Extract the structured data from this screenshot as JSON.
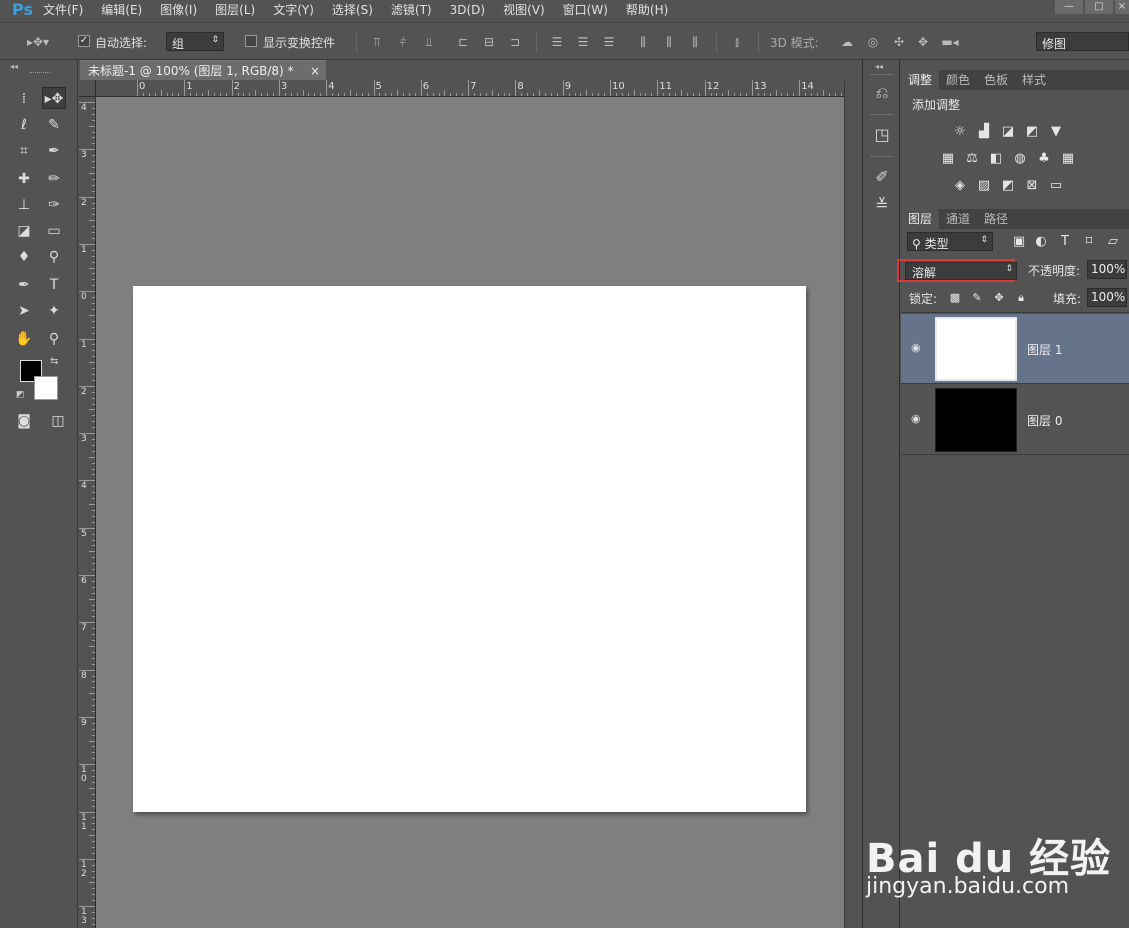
{
  "app": {
    "logo": "Ps"
  },
  "menubar": {
    "items": [
      "文件(F)",
      "编辑(E)",
      "图像(I)",
      "图层(L)",
      "文字(Y)",
      "选择(S)",
      "滤镜(T)",
      "3D(D)",
      "视图(V)",
      "窗口(W)",
      "帮助(H)"
    ]
  },
  "options": {
    "auto_select_label": "自动选择:",
    "auto_select_value": "组",
    "show_transform_label": "显示变换控件",
    "mode_3d_label": "3D 模式:",
    "workspace": "修图"
  },
  "document": {
    "tab_title": "未标题-1 @ 100% (图层 1, RGB/8) *",
    "close": "×",
    "ruler_top": [
      "0",
      "1",
      "2",
      "3",
      "4",
      "5",
      "6",
      "7",
      "8",
      "9",
      "10",
      "11",
      "12",
      "13",
      "14"
    ],
    "ruler_left": [
      "4",
      "3",
      "2",
      "1",
      "0",
      "1",
      "2",
      "3",
      "4",
      "5",
      "6",
      "7",
      "8",
      "9",
      "10",
      "11",
      "12",
      "13"
    ]
  },
  "adjust_panel": {
    "tabs": [
      "调整",
      "颜色",
      "色板",
      "样式"
    ],
    "add_adjustment": "添加调整"
  },
  "layers_panel": {
    "tabs": [
      "图层",
      "通道",
      "路径"
    ],
    "filter_kind": "类型",
    "blend_mode": "溶解",
    "opacity_label": "不透明度:",
    "opacity_value": "100%",
    "lock_label": "锁定:",
    "fill_label": "填充:",
    "fill_value": "100%",
    "layers": [
      {
        "name": "图层 1",
        "thumb_color": "#ffffff",
        "selected": true
      },
      {
        "name": "图层 0",
        "thumb_color": "#000000",
        "selected": false
      }
    ]
  },
  "watermark": {
    "logo": "Bai du 经验",
    "url": "jingyan.baidu.com"
  }
}
